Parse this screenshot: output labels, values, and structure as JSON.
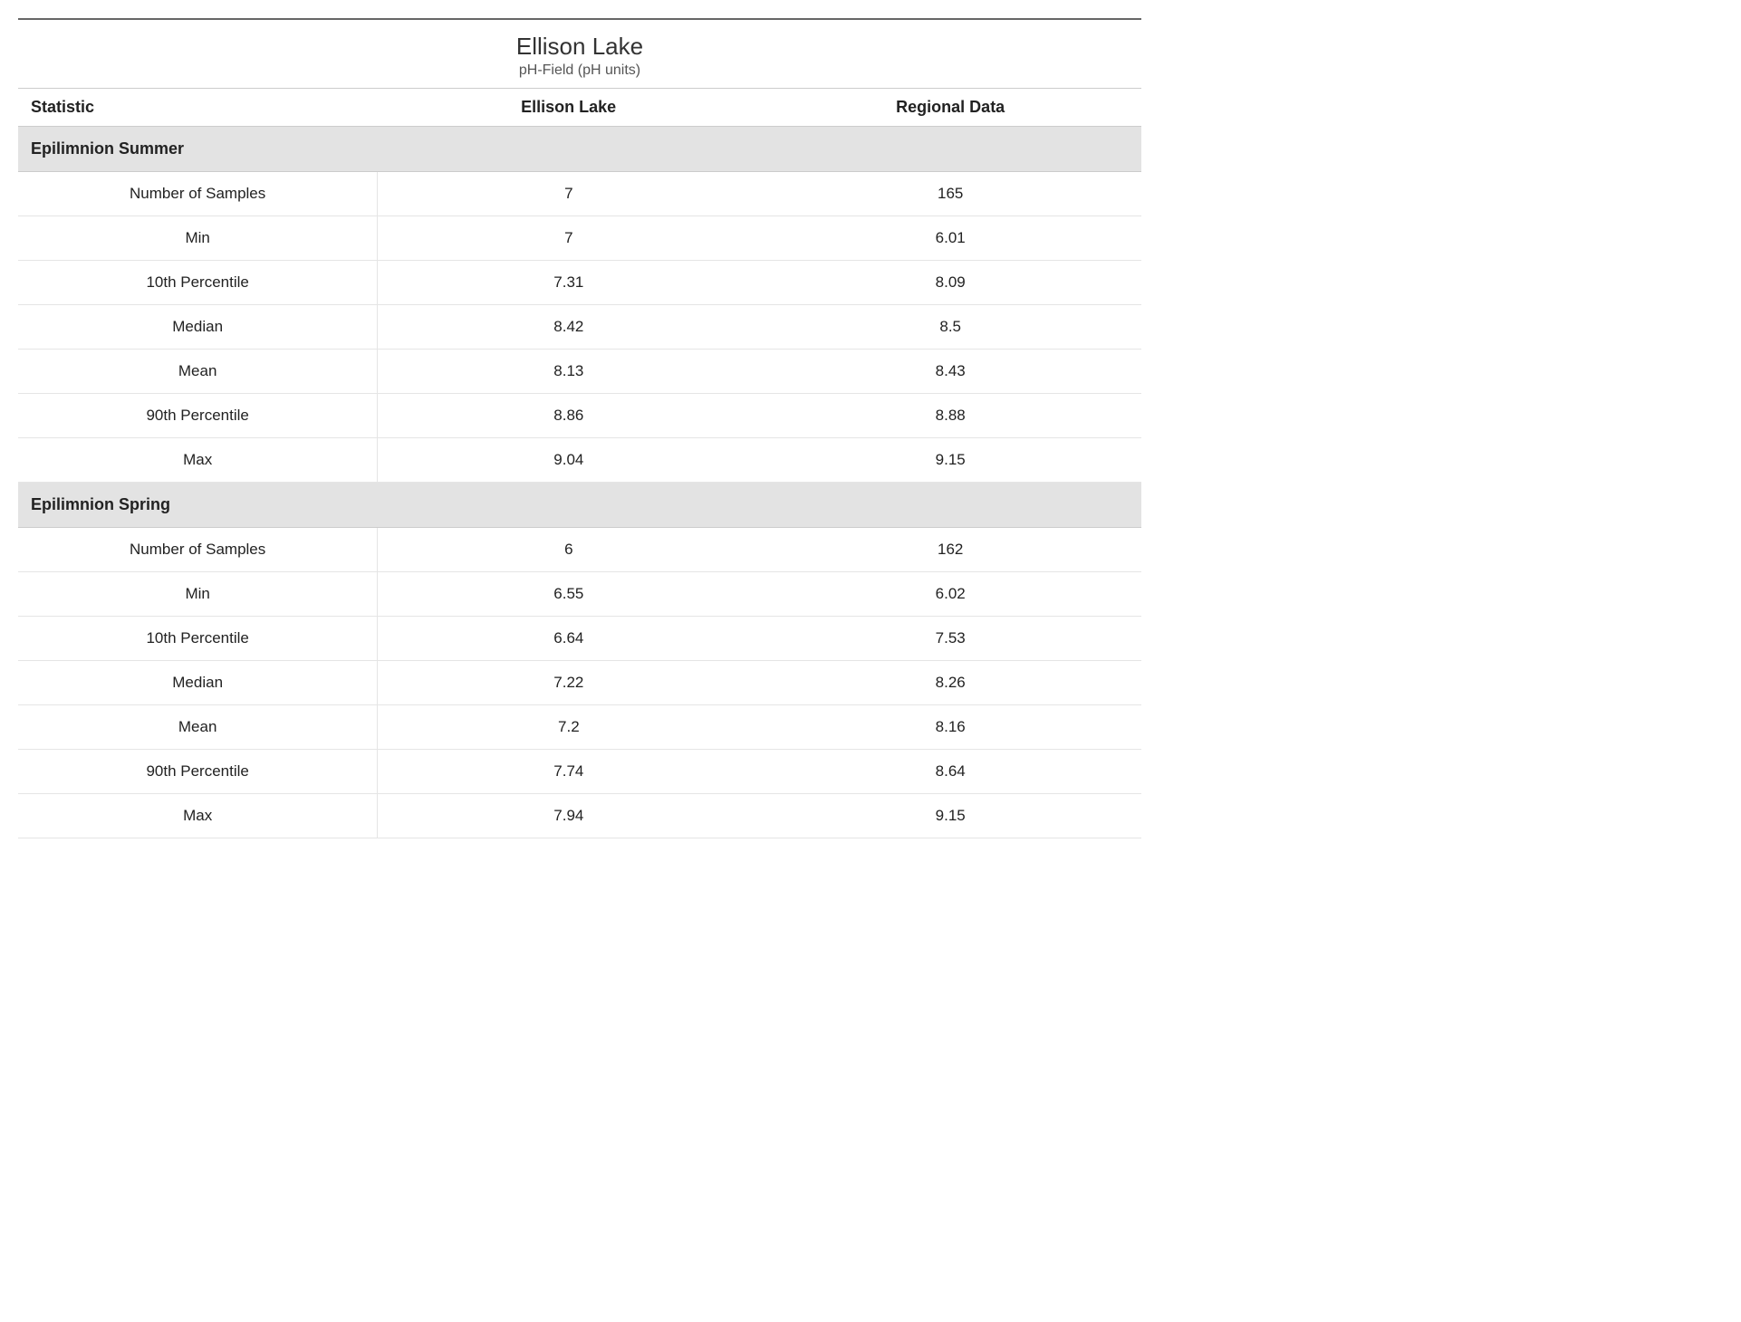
{
  "title": "Ellison Lake",
  "subtitle": "pH-Field (pH units)",
  "columns": {
    "stat": "Statistic",
    "lake": "Ellison Lake",
    "region": "Regional Data"
  },
  "sections": [
    {
      "name": "Epilimnion Summer",
      "rows": [
        {
          "stat": "Number of Samples",
          "lake": "7",
          "region": "165"
        },
        {
          "stat": "Min",
          "lake": "7",
          "region": "6.01"
        },
        {
          "stat": "10th Percentile",
          "lake": "7.31",
          "region": "8.09"
        },
        {
          "stat": "Median",
          "lake": "8.42",
          "region": "8.5"
        },
        {
          "stat": "Mean",
          "lake": "8.13",
          "region": "8.43"
        },
        {
          "stat": "90th Percentile",
          "lake": "8.86",
          "region": "8.88"
        },
        {
          "stat": "Max",
          "lake": "9.04",
          "region": "9.15"
        }
      ]
    },
    {
      "name": "Epilimnion Spring",
      "rows": [
        {
          "stat": "Number of Samples",
          "lake": "6",
          "region": "162"
        },
        {
          "stat": "Min",
          "lake": "6.55",
          "region": "6.02"
        },
        {
          "stat": "10th Percentile",
          "lake": "6.64",
          "region": "7.53"
        },
        {
          "stat": "Median",
          "lake": "7.22",
          "region": "8.26"
        },
        {
          "stat": "Mean",
          "lake": "7.2",
          "region": "8.16"
        },
        {
          "stat": "90th Percentile",
          "lake": "7.74",
          "region": "8.64"
        },
        {
          "stat": "Max",
          "lake": "7.94",
          "region": "9.15"
        }
      ]
    }
  ]
}
